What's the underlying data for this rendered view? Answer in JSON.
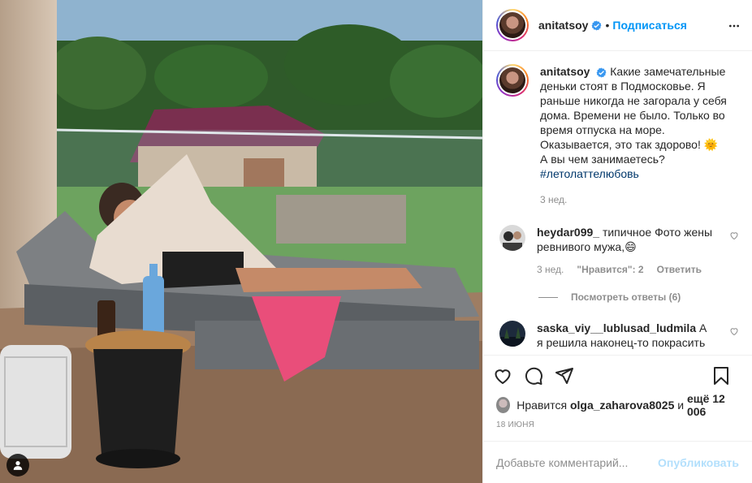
{
  "post": {
    "username": "anitatsoy",
    "follow_label": "Подписаться",
    "separator": "•",
    "caption_text": "Какие замечательные деньки стоят в Подмосковье. Я раньше никогда не загорала у себя дома. Времени не было. Только во время отпуска на море. Оказывается, это так здорово! 🌞 А вы чем занимаетесь?",
    "hashtag": "#летолаттелюбовь",
    "caption_time": "3 нед.",
    "likes_prefix": "Нравится",
    "likes_user": "olga_zaharova8025",
    "likes_mid": "и",
    "likes_more": "ещё 12 006",
    "date": "18 ИЮНЯ",
    "icons": {
      "more": "more-horizontal-icon",
      "like": "heart-icon",
      "comment": "comment-icon",
      "share": "share-icon",
      "save": "bookmark-icon",
      "verified": "verified-badge-icon",
      "user_tag": "user-tag-icon"
    },
    "colors": {
      "accent": "#0095f6",
      "hashtag": "#00376b",
      "muted": "#8e8e8e"
    }
  },
  "comments": [
    {
      "username": "heydar099_",
      "text": "типичное Фото жены ревнивого мужа,😄",
      "time": "3 нед.",
      "likes_label": "\"Нравится\": 2",
      "reply_label": "Ответить"
    },
    {
      "username": "saska_viy__lublusad_ludmila",
      "text": "А я решила наконец-то покрасить"
    }
  ],
  "view_replies": "Посмотреть ответы (6)",
  "comment_box": {
    "placeholder": "Добавьте комментарий...",
    "publish_label": "Опубликовать"
  }
}
